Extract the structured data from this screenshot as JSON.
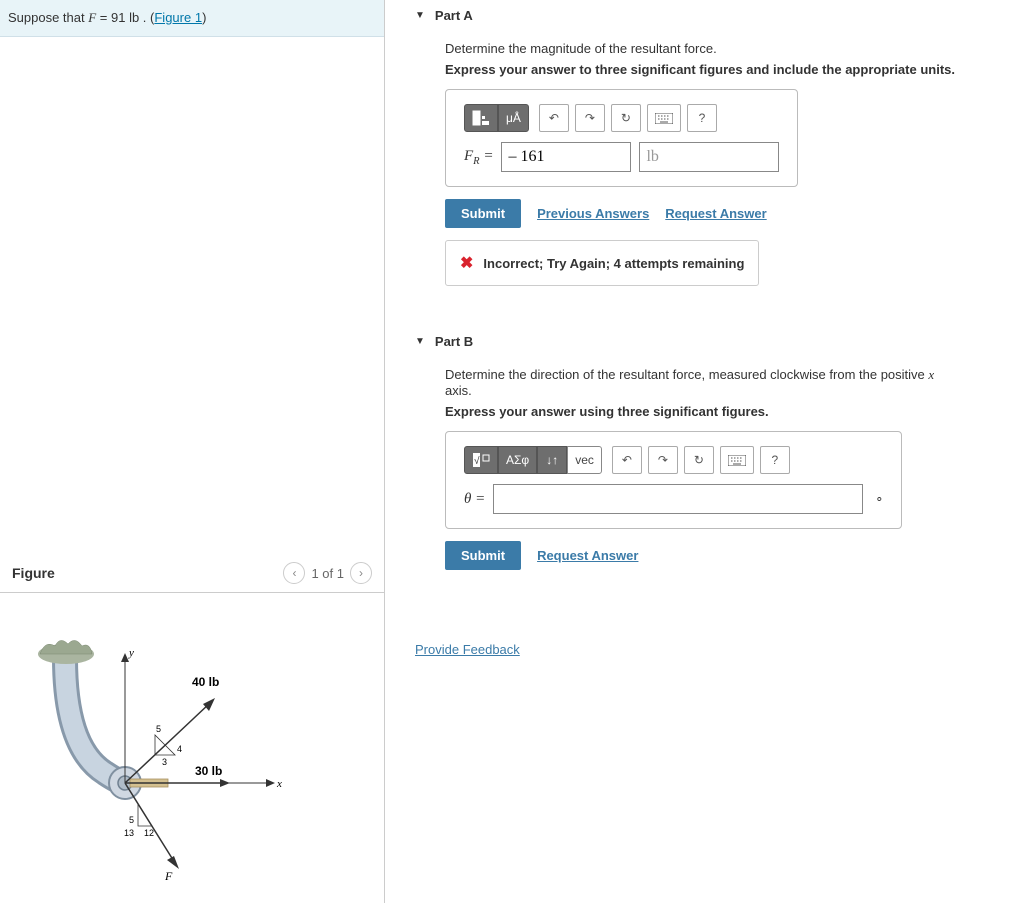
{
  "problem": {
    "prefix": "Suppose that ",
    "var": "F",
    "eq": " = 91  lb . (",
    "link": "Figure 1",
    "suffix": ")"
  },
  "figure": {
    "title": "Figure",
    "nav": "1 of 1",
    "labels": {
      "y": "y",
      "x": "x",
      "f40": "40 lb",
      "f30": "30 lb",
      "F": "F",
      "t5a": "5",
      "t4": "4",
      "t3": "3",
      "t5b": "5",
      "t13": "13",
      "t12": "12"
    }
  },
  "partA": {
    "title": "Part A",
    "instruction": "Determine the magnitude of the resultant force.",
    "bold": "Express your answer to three significant figures and include the appropriate units.",
    "label_var": "F",
    "label_sub": "R",
    "label_eq": " = ",
    "value": "– 161",
    "unit": "lb",
    "submit": "Submit",
    "prev": "Previous Answers",
    "req": "Request Answer",
    "feedback": "Incorrect; Try Again; 4 attempts remaining",
    "tools": {
      "units": "μÅ",
      "help": "?"
    }
  },
  "partB": {
    "title": "Part B",
    "instruction_pre": "Determine the direction of the resultant force, measured clockwise from the positive ",
    "instruction_var": "x",
    "instruction_post": " axis.",
    "bold": "Express your answer using three significant figures.",
    "label": "θ = ",
    "value": "",
    "unit_symbol": "∘",
    "submit": "Submit",
    "req": "Request Answer",
    "tools": {
      "greek": "ΑΣφ",
      "updown": "↓↑",
      "vec": "vec",
      "help": "?"
    }
  },
  "feedback_link": "Provide Feedback"
}
